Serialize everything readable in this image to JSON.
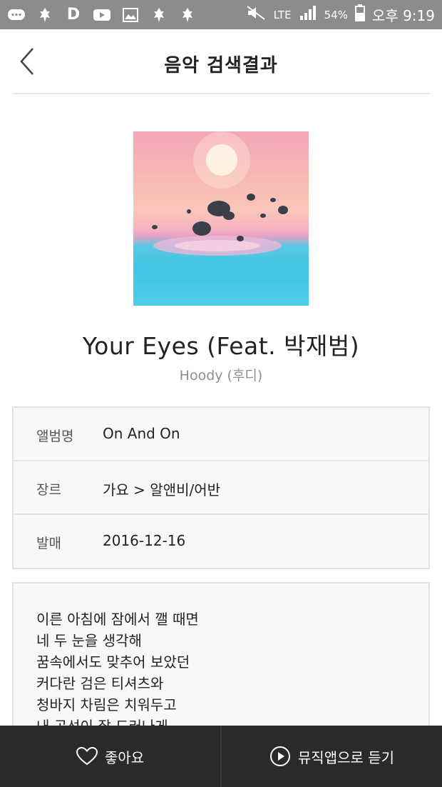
{
  "status_bar": {
    "icons": [
      "chat-icon",
      "android-icon",
      "d-icon",
      "youtube-icon",
      "gallery-icon",
      "android-icon",
      "android-icon",
      "mute-icon"
    ],
    "network": "LTE",
    "battery": "54%",
    "time": "오후 9:19"
  },
  "header": {
    "title": "음악 검색결과"
  },
  "song": {
    "title": "Your Eyes (Feat. 박재범)",
    "artist": "Hoody (후디)"
  },
  "info": {
    "rows": [
      {
        "label": "앨범명",
        "value": "On And On"
      },
      {
        "label": "장르",
        "value": "가요 > 알앤비/어반"
      },
      {
        "label": "발매",
        "value": "2016-12-16"
      }
    ]
  },
  "lyrics": [
    "이른 아침에 잠에서 깰 때면",
    "네 두 눈을 생각해",
    "꿈속에서도 맞추어 보았던",
    "커다란 검은 티셔츠와",
    "청바지 차림은 치워두고",
    "내 곡선이 잘 드러나게"
  ],
  "bottom_bar": {
    "like_label": "좋아요",
    "listen_label": "뮤직앱으로 듣기"
  },
  "colors": {
    "status_bar": "#8c8c8c",
    "bottom_bar": "#2a2a2a",
    "box_bg": "#f8f8f8"
  }
}
